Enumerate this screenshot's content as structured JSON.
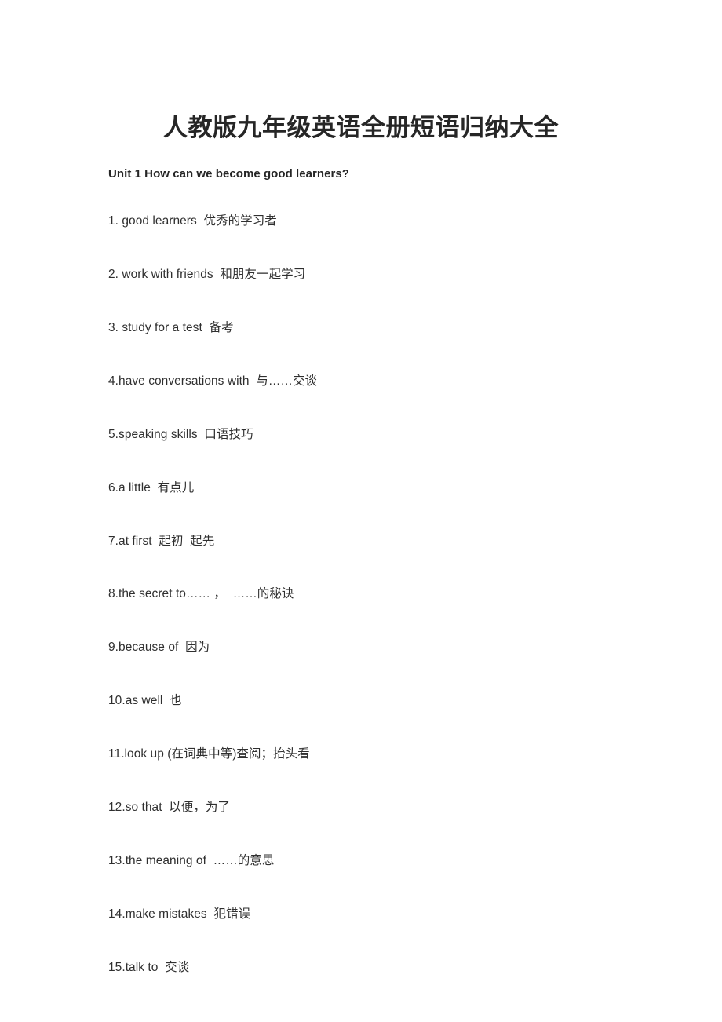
{
  "document": {
    "title": "人教版九年级英语全册短语归纳大全",
    "unit_heading": "Unit 1 How can we become good learners?",
    "phrases": [
      "1. good learners  优秀的学习者",
      "2. work with friends  和朋友一起学习",
      "3. study for a test  备考",
      "4.have conversations with  与……交谈",
      "5.speaking skills  口语技巧",
      "6.a little  有点儿",
      "7.at first  起初  起先",
      "8.the secret to…… ，  ……的秘诀",
      "9.because of  因为",
      "10.as well  也",
      "11.look up (在词典中等)查阅；抬头看",
      "12.so that  以便，为了",
      "13.the meaning of  ……的意思",
      "14.make mistakes  犯错误",
      "15.talk to  交谈"
    ]
  },
  "colors": {
    "page_background": "#ffffff",
    "title_text": "#262626",
    "body_text": "#2f2f2f"
  }
}
